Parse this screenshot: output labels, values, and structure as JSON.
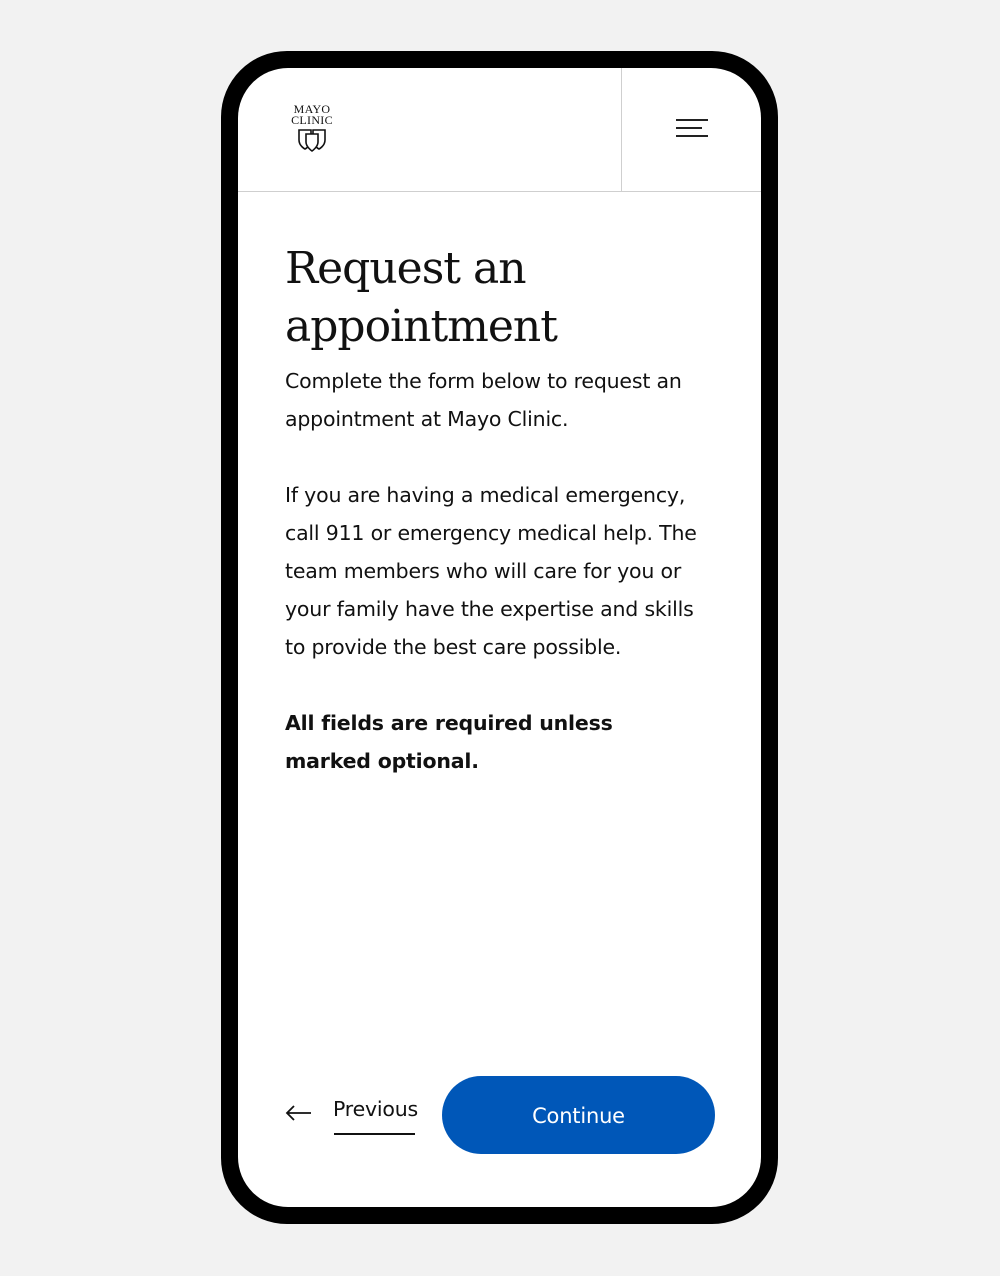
{
  "header": {
    "logo_line1": "MAYO",
    "logo_line2": "CLINIC",
    "menu_icon": "hamburger-menu-icon"
  },
  "main": {
    "title": "Request an appointment",
    "intro": "Complete the form below to request an appointment at Mayo Clinic.",
    "emergency_notice": "If you are having a medical emergency, call 911 or emergency medical help. The team members who will care for you or your family have the expertise and skills to provide the best care possible.",
    "required_note": "All fields are required unless marked optional."
  },
  "footer": {
    "previous_label": "Previous",
    "previous_icon": "arrow-left-icon",
    "continue_label": "Continue"
  },
  "colors": {
    "accent": "#0057b8",
    "background": "#f2f2f2",
    "text": "#111111"
  }
}
